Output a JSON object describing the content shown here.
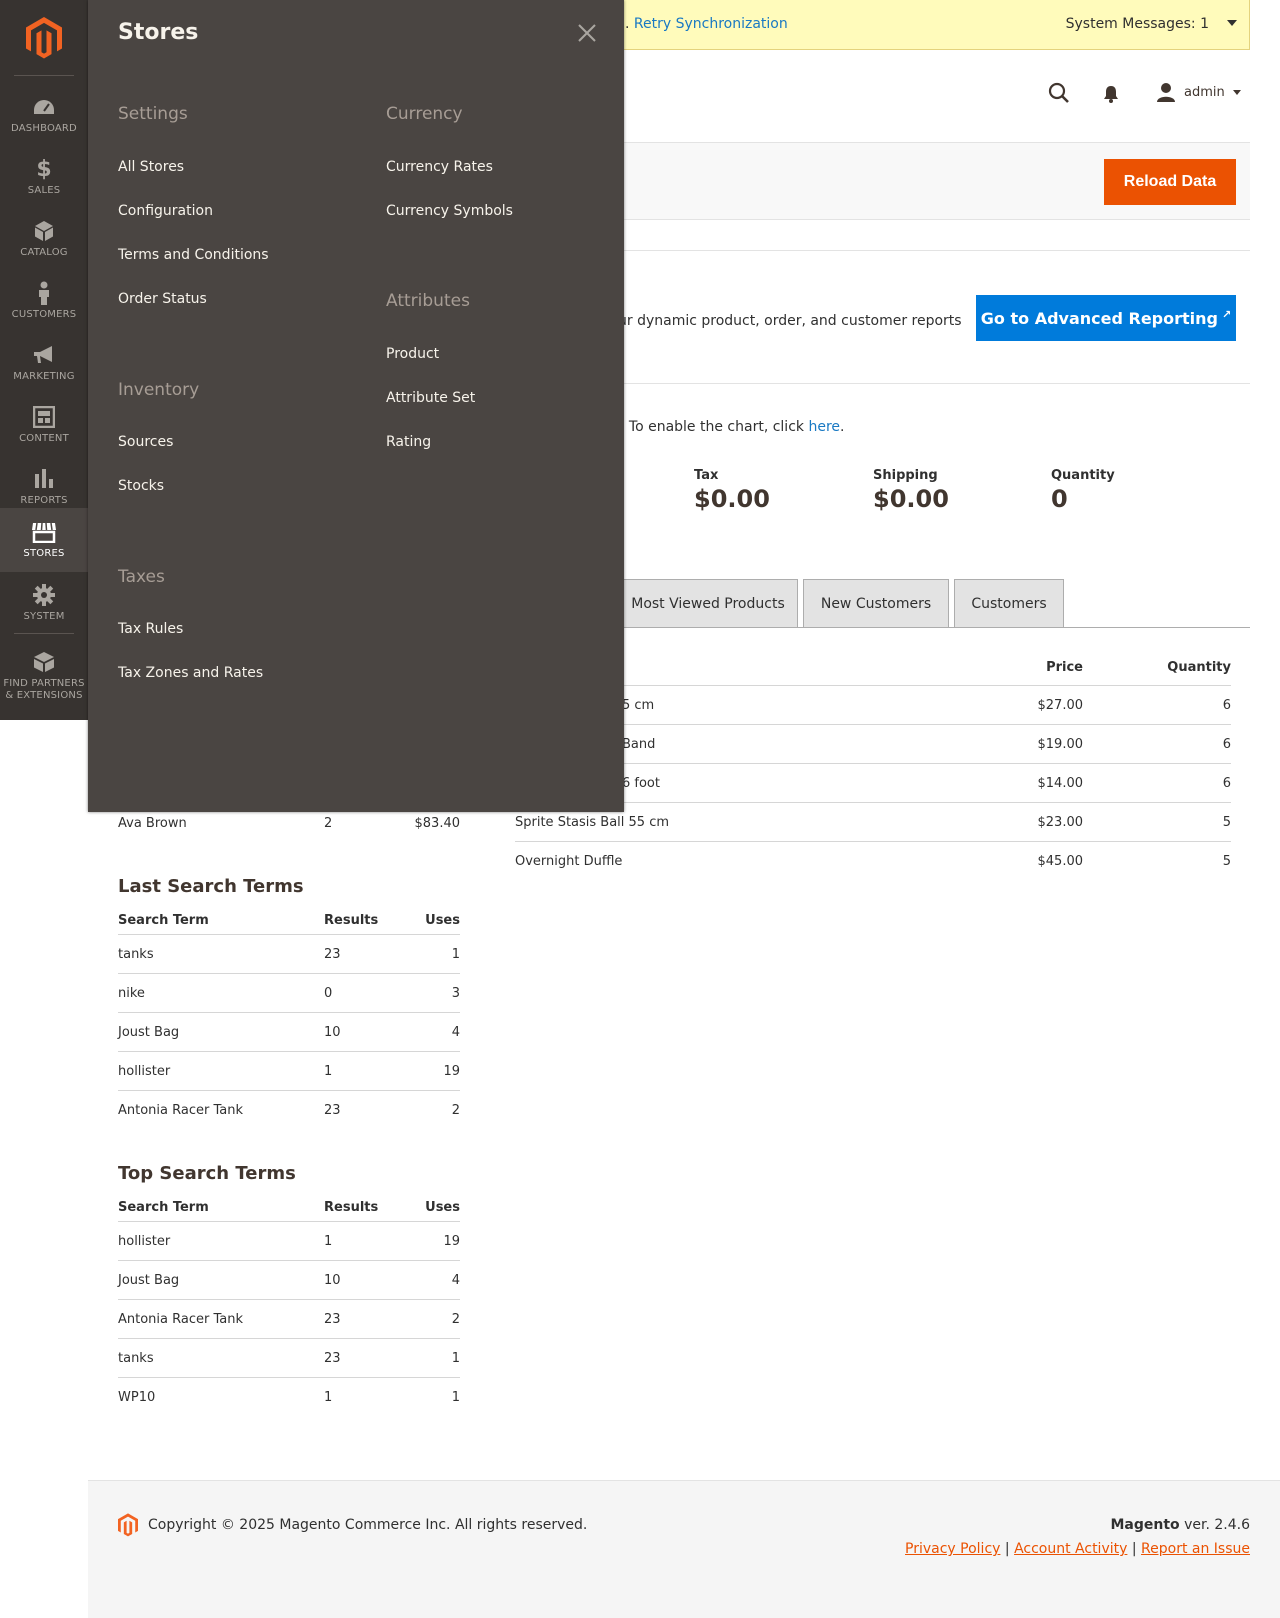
{
  "nav": {
    "items": [
      {
        "label": "Dashboard",
        "icon": "dashboard-icon"
      },
      {
        "label": "Sales",
        "icon": "dollar-icon"
      },
      {
        "label": "Catalog",
        "icon": "cube-icon"
      },
      {
        "label": "Customers",
        "icon": "person-icon"
      },
      {
        "label": "Marketing",
        "icon": "megaphone-icon"
      },
      {
        "label": "Content",
        "icon": "layout-icon"
      },
      {
        "label": "Reports",
        "icon": "bar-chart-icon"
      },
      {
        "label": "Stores",
        "icon": "store-icon"
      },
      {
        "label": "System",
        "icon": "gear-icon"
      },
      {
        "label": "Find Partners",
        "label2": "& Extensions",
        "icon": "boxes-icon"
      }
    ],
    "active": "Stores"
  },
  "notice": {
    "retry_prefix": ".",
    "retry_link": "Retry Synchronization",
    "system_messages": "System Messages: 1"
  },
  "header": {
    "user": "admin"
  },
  "actions": {
    "reload": "Reload Data"
  },
  "advanced": {
    "text": "ur dynamic product, order, and customer reports",
    "button": "Go to Advanced Reporting"
  },
  "chart_note": {
    "prefix": ". To enable the chart, click ",
    "link": "here",
    "suffix": "."
  },
  "totals": [
    {
      "label": "Tax",
      "value": "$0.00"
    },
    {
      "label": "Shipping",
      "value": "$0.00"
    },
    {
      "label": "Quantity",
      "value": "0"
    }
  ],
  "tabs": [
    "Most Viewed Products",
    "New Customers",
    "Customers"
  ],
  "products": {
    "headers": {
      "price": "Price",
      "quantity": "Quantity"
    },
    "rows": [
      {
        "name": "5 cm",
        "price": "$27.00",
        "qty": "6"
      },
      {
        "name": "Band",
        "price": "$19.00",
        "qty": "6"
      },
      {
        "name": "6 foot",
        "price": "$14.00",
        "qty": "6"
      },
      {
        "name": "Sprite Stasis Ball 55 cm",
        "price": "$23.00",
        "qty": "5"
      },
      {
        "name": "Overnight Duffle",
        "price": "$45.00",
        "qty": "5"
      }
    ]
  },
  "customer_row": {
    "name": "Ava Brown",
    "orders": "2",
    "total": "$83.40"
  },
  "last_search": {
    "title": "Last Search Terms",
    "headers": [
      "Search Term",
      "Results",
      "Uses"
    ],
    "rows": [
      [
        "tanks",
        "23",
        "1"
      ],
      [
        "nike",
        "0",
        "3"
      ],
      [
        "Joust Bag",
        "10",
        "4"
      ],
      [
        "hollister",
        "1",
        "19"
      ],
      [
        "Antonia Racer Tank",
        "23",
        "2"
      ]
    ]
  },
  "top_search": {
    "title": "Top Search Terms",
    "headers": [
      "Search Term",
      "Results",
      "Uses"
    ],
    "rows": [
      [
        "hollister",
        "1",
        "19"
      ],
      [
        "Joust Bag",
        "10",
        "4"
      ],
      [
        "Antonia Racer Tank",
        "23",
        "2"
      ],
      [
        "tanks",
        "23",
        "1"
      ],
      [
        "WP10",
        "1",
        "1"
      ]
    ]
  },
  "footer": {
    "copyright": "Copyright © 2025 Magento Commerce Inc. All rights reserved.",
    "brand": "Magento",
    "version": " ver. 2.4.6",
    "links": [
      "Privacy Policy",
      "Account Activity",
      "Report an Issue"
    ]
  },
  "flyout": {
    "title": "Stores",
    "groups": {
      "settings": {
        "title": "Settings",
        "links": [
          "All Stores",
          "Configuration",
          "Terms and Conditions",
          "Order Status"
        ]
      },
      "inventory": {
        "title": "Inventory",
        "links": [
          "Sources",
          "Stocks"
        ]
      },
      "taxes": {
        "title": "Taxes",
        "links": [
          "Tax Rules",
          "Tax Zones and Rates"
        ]
      },
      "currency": {
        "title": "Currency",
        "links": [
          "Currency Rates",
          "Currency Symbols"
        ]
      },
      "attributes": {
        "title": "Attributes",
        "links": [
          "Product",
          "Attribute Set",
          "Rating"
        ]
      }
    }
  },
  "colors": {
    "accent": "#eb5202",
    "link": "#1979c3",
    "nav_bg": "#373330",
    "flyout_bg": "#4a4542"
  }
}
